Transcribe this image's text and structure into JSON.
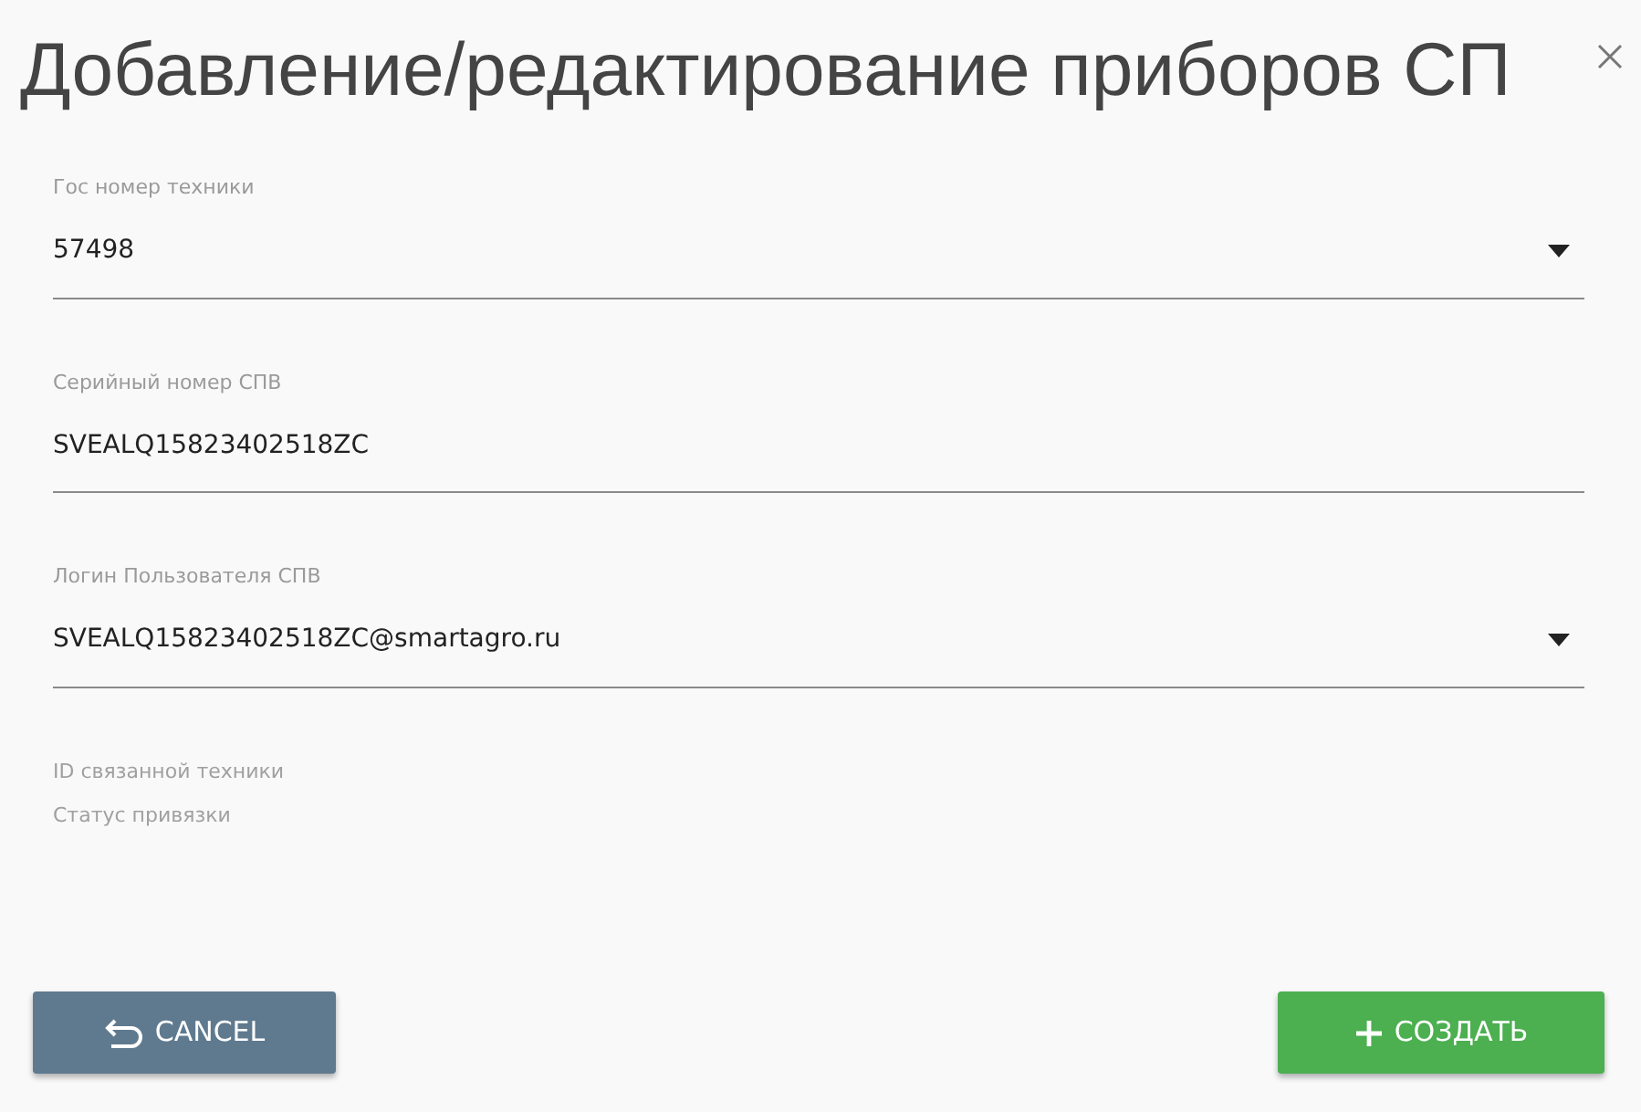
{
  "dialog": {
    "title": "Добавление/редактирование приборов СП",
    "fields": [
      {
        "kind": "select",
        "label": "Гос номер техники",
        "value": "57498"
      },
      {
        "kind": "text",
        "label": "Серийный номер СПВ",
        "value": "SVEALQ15823402518ZC"
      },
      {
        "kind": "select",
        "label": "Логин Пользователя СПВ",
        "value": "SVEALQ15823402518ZC@smartagro.ru"
      }
    ],
    "info": [
      "ID связанной техники",
      "Статус привязки"
    ],
    "buttons": [
      {
        "kind": "cancel",
        "label": "CANCEL"
      },
      {
        "kind": "create",
        "label": "СОЗДАТЬ"
      }
    ]
  }
}
